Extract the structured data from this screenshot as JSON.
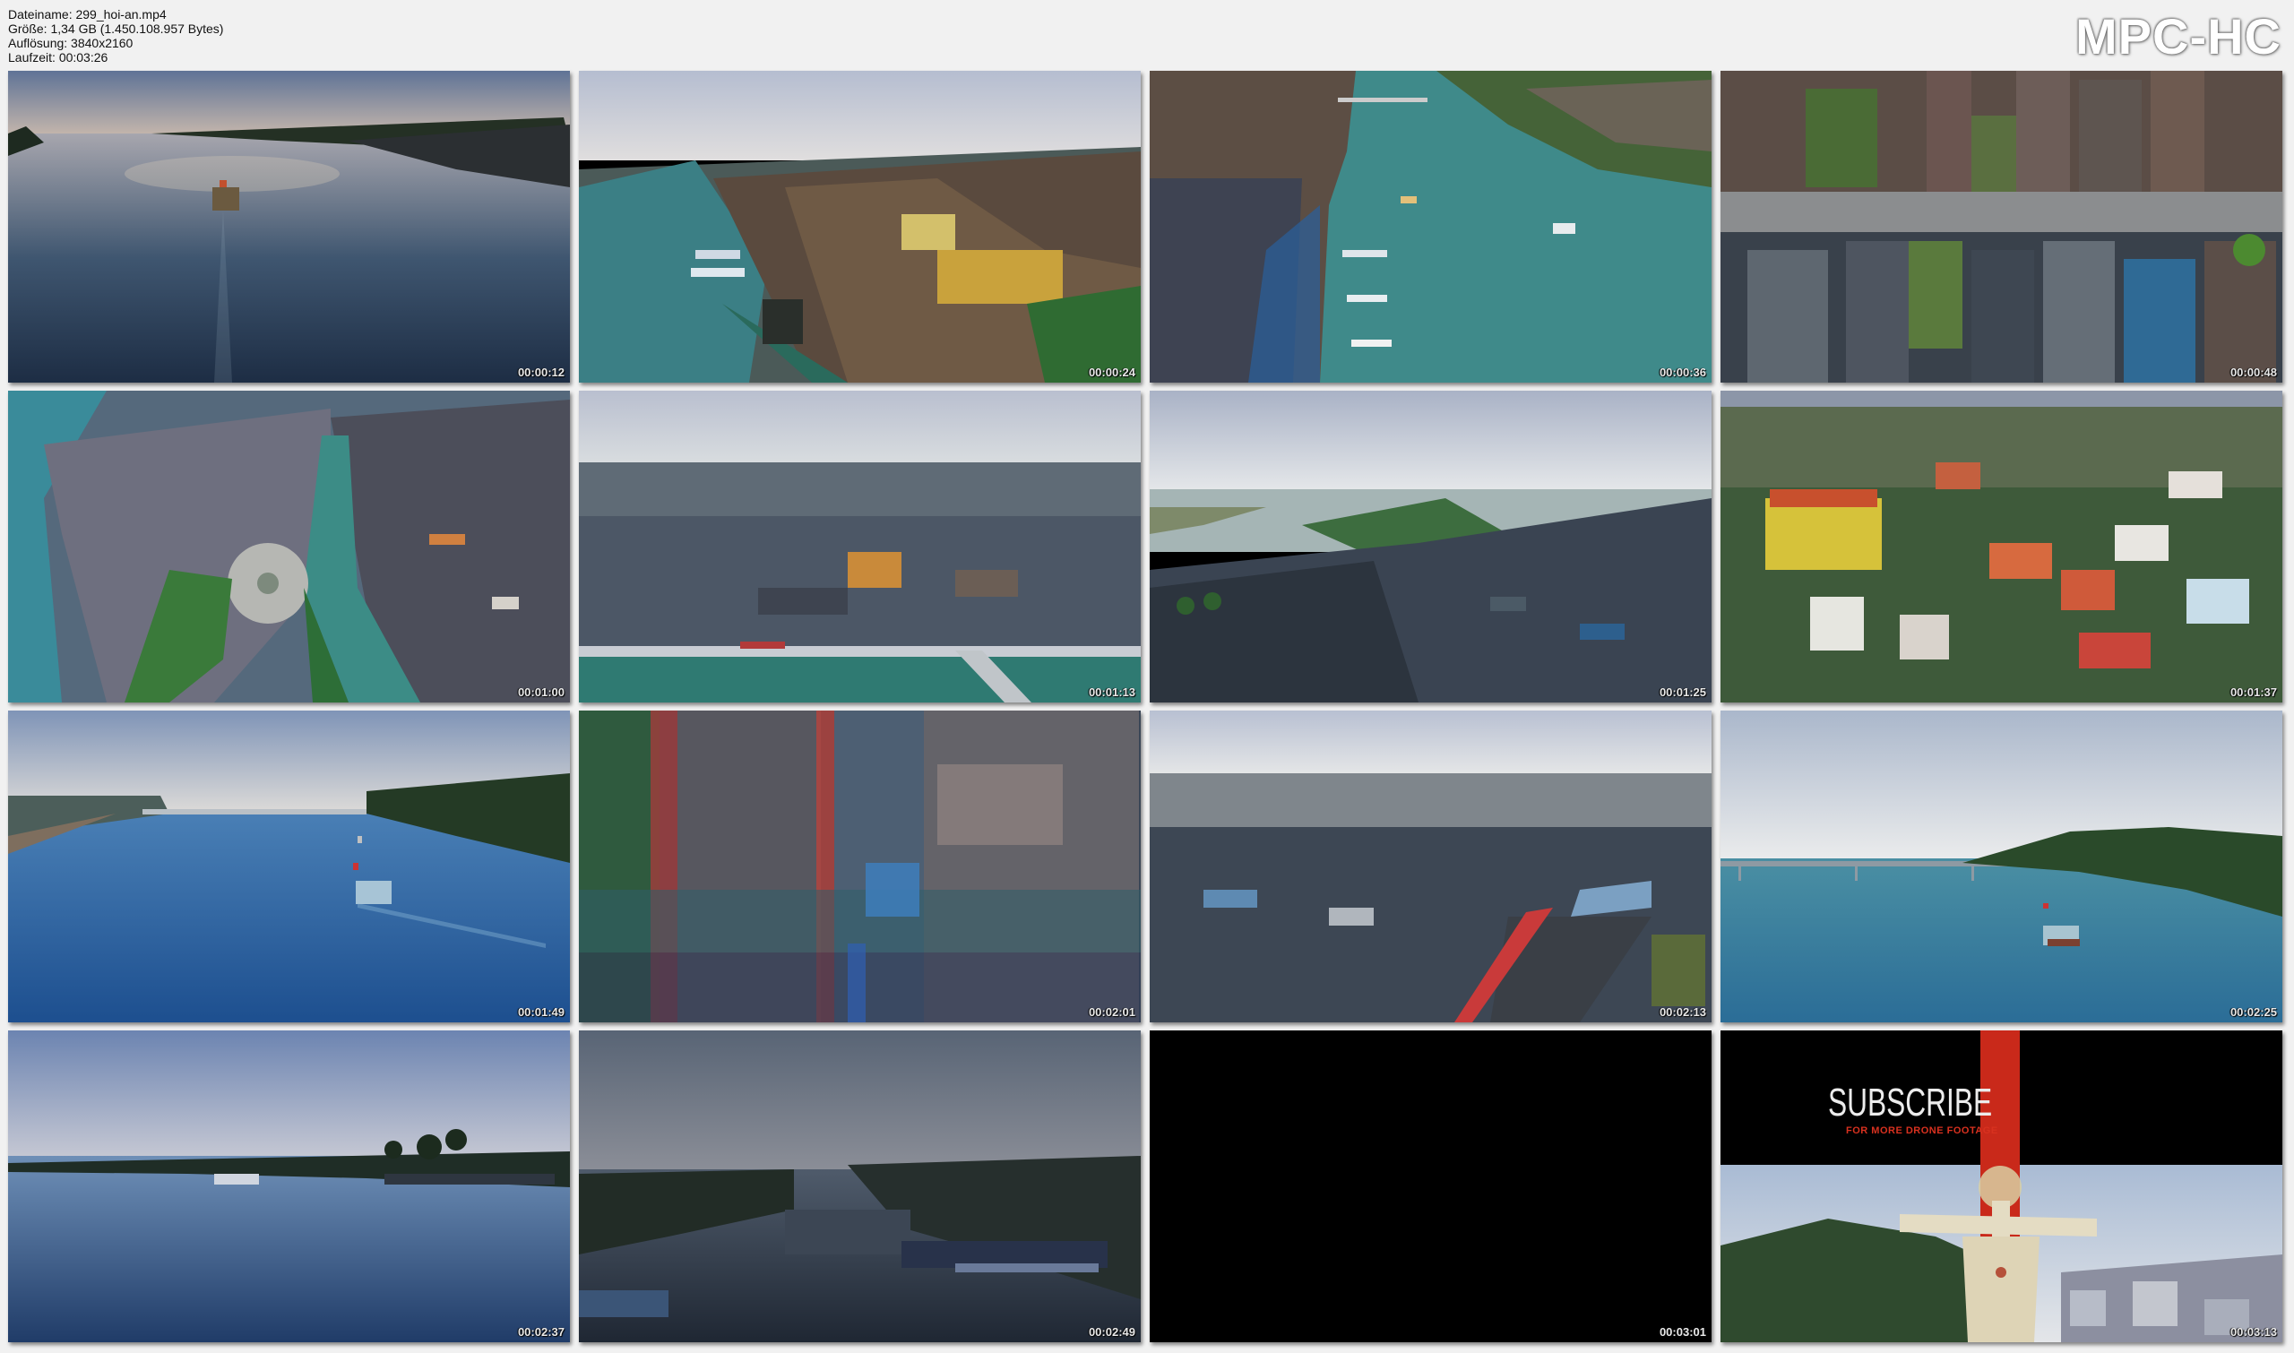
{
  "file_info": {
    "name_line": "Dateiname: 299_hoi-an.mp4",
    "size_line": "Größe: 1,34 GB (1.450.108.957 Bytes)",
    "resolution_line": "Auflösung: 3840x2160",
    "duration_line": "Laufzeit: 00:03:26"
  },
  "brand": "MPC-HC",
  "thumbnails": [
    {
      "time": "00:00:12"
    },
    {
      "time": "00:00:24"
    },
    {
      "time": "00:00:36"
    },
    {
      "time": "00:00:48"
    },
    {
      "time": "00:01:00"
    },
    {
      "time": "00:01:13"
    },
    {
      "time": "00:01:25"
    },
    {
      "time": "00:01:37"
    },
    {
      "time": "00:01:49"
    },
    {
      "time": "00:02:01"
    },
    {
      "time": "00:02:13"
    },
    {
      "time": "00:02:25"
    },
    {
      "time": "00:02:37"
    },
    {
      "time": "00:02:49"
    },
    {
      "time": "00:03:01"
    },
    {
      "time": "00:03:13"
    }
  ],
  "subscribe": {
    "title": "SUBSCRIBE",
    "tagline": "FOR MORE DRONE FOOTAGE"
  },
  "colors": {
    "background": "#f1f1f1",
    "subscribe_accent": "#d8311f"
  }
}
